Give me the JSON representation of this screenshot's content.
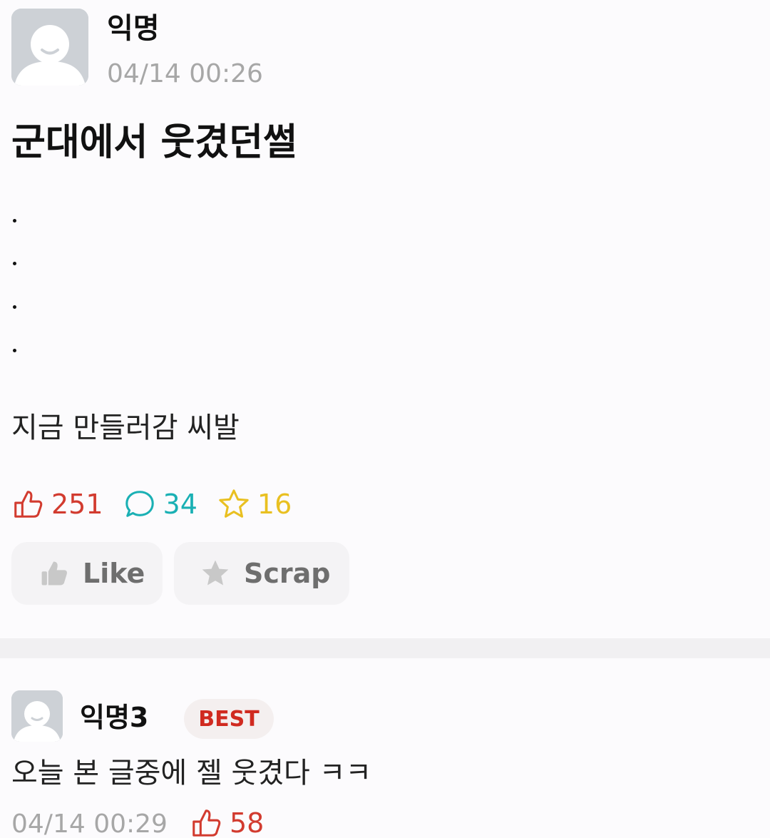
{
  "post": {
    "author": "익명",
    "time": "04/14 00:26",
    "title": "군대에서 웃겼던썰",
    "body": "지금 만들러감 씨발",
    "stats": {
      "likes": "251",
      "comments": "34",
      "scraps": "16"
    },
    "actions": {
      "like_label": "Like",
      "scrap_label": "Scrap"
    }
  },
  "comment": {
    "author": "익명3",
    "badge": "BEST",
    "text": "오늘 본 글중에 젤 웃겼다 ㅋㅋ",
    "time": "04/14 00:29",
    "likes": "58"
  },
  "icons": {
    "avatar": "default-avatar-icon",
    "like": "thumbs-up-icon",
    "comment": "speech-bubble-icon",
    "scrap": "star-icon"
  },
  "colors": {
    "like": "#d23b2f",
    "comment": "#1ab0b4",
    "scrap": "#e9c021",
    "best": "#d02a20"
  }
}
